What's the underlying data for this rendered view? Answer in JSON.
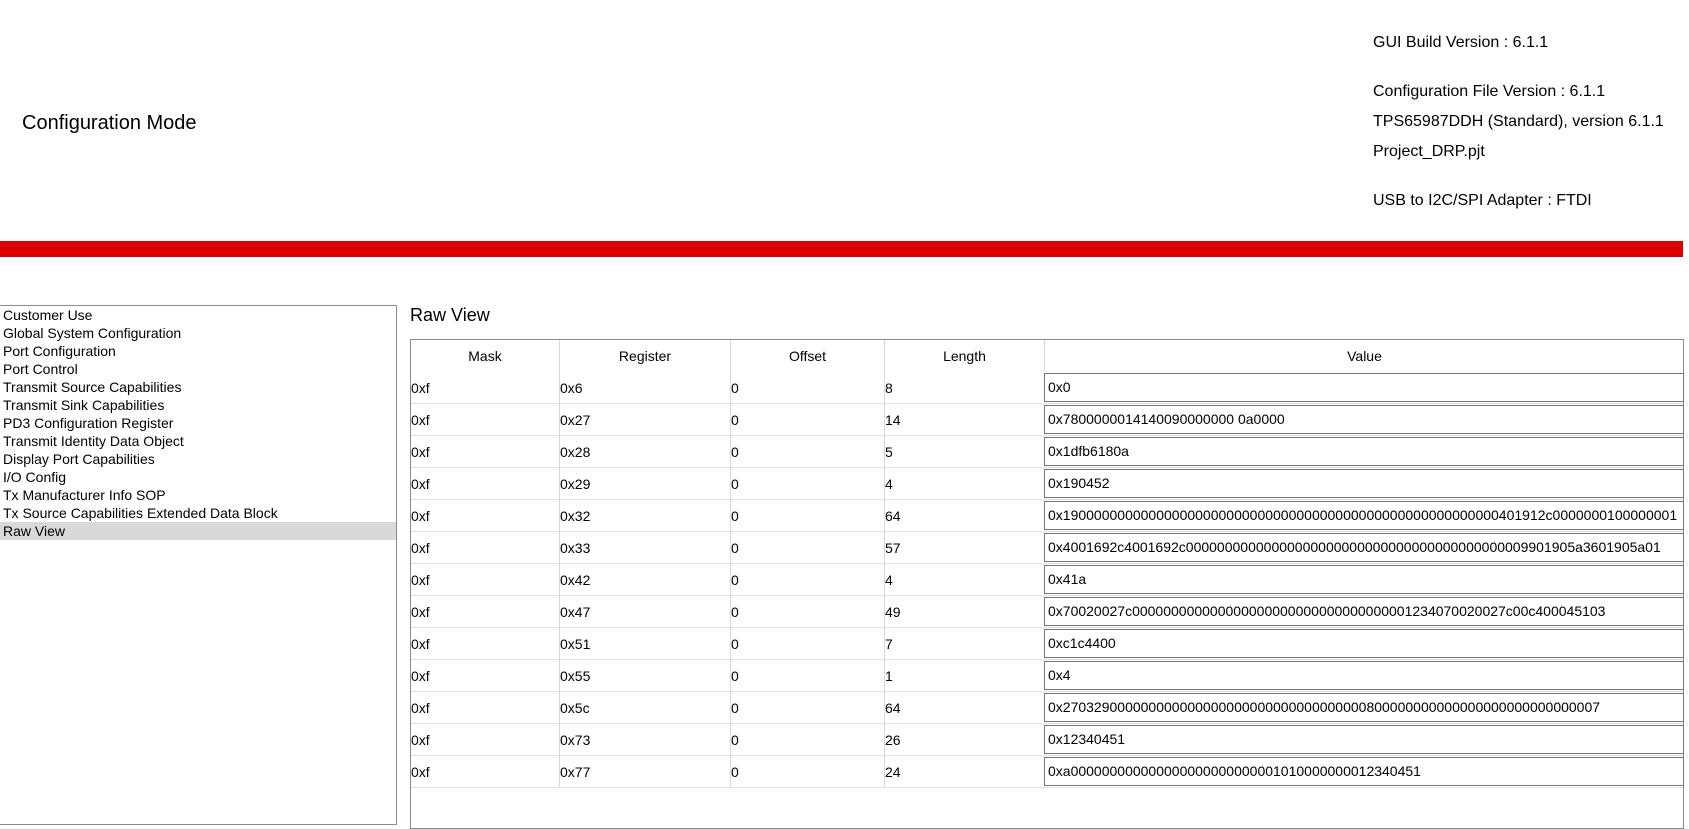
{
  "header": {
    "title": "Configuration Mode",
    "gui_build": "GUI Build Version : 6.1.1",
    "config_file": "Configuration File Version : 6.1.1",
    "device": "TPS65987DDH (Standard), version 6.1.1",
    "project": "Project_DRP.pjt",
    "adapter": "USB to I2C/SPI Adapter : FTDI"
  },
  "colors": {
    "accent_bar": "#dc0000",
    "selected_bg": "#d9d9d9"
  },
  "sidebar": {
    "items": [
      {
        "label": "Customer Use"
      },
      {
        "label": "Global System Configuration"
      },
      {
        "label": "Port Configuration"
      },
      {
        "label": "Port Control"
      },
      {
        "label": "Transmit Source Capabilities"
      },
      {
        "label": "Transmit Sink Capabilities"
      },
      {
        "label": "PD3 Configuration Register"
      },
      {
        "label": "Transmit Identity Data Object"
      },
      {
        "label": "Display Port Capabilities"
      },
      {
        "label": "I/O Config"
      },
      {
        "label": "Tx Manufacturer Info SOP"
      },
      {
        "label": "Tx Source Capabilities Extended Data Block"
      },
      {
        "label": "Raw View"
      }
    ],
    "selected": "Raw View"
  },
  "main": {
    "title": "Raw View",
    "columns": [
      "Mask",
      "Register",
      "Offset",
      "Length",
      "Value"
    ],
    "rows": [
      [
        "0xf",
        "0x6",
        "0",
        "8",
        "0x0"
      ],
      [
        "0xf",
        "0x27",
        "0",
        "14",
        "0x7800000014140090000000 0a0000"
      ],
      [
        "0xf",
        "0x28",
        "0",
        "5",
        "0x1dfb6180a"
      ],
      [
        "0xf",
        "0x29",
        "0",
        "4",
        "0x190452"
      ],
      [
        "0xf",
        "0x32",
        "0",
        "64",
        "0x19000000000000000000000000000000000000000000000000000000401912c0000000100000001"
      ],
      [
        "0xf",
        "0x33",
        "0",
        "57",
        "0x4001692c4001692c00000000000000000000000000000000000000000009901905a3601905a01"
      ],
      [
        "0xf",
        "0x42",
        "0",
        "4",
        "0x41a"
      ],
      [
        "0xf",
        "0x47",
        "0",
        "49",
        "0x70020027c000000000000000000000000000000000001234070020027c00c400045103"
      ],
      [
        "0xf",
        "0x51",
        "0",
        "7",
        "0xc1c4400"
      ],
      [
        "0xf",
        "0x55",
        "0",
        "1",
        "0x4"
      ],
      [
        "0xf",
        "0x5c",
        "0",
        "64",
        "0x270329000000000000000000000000000000000800000000000000000000000000007"
      ],
      [
        "0xf",
        "0x73",
        "0",
        "26",
        "0x12340451"
      ],
      [
        "0xf",
        "0x77",
        "0",
        "24",
        "0xa000000000000000000000000001010000000012340451"
      ]
    ]
  }
}
